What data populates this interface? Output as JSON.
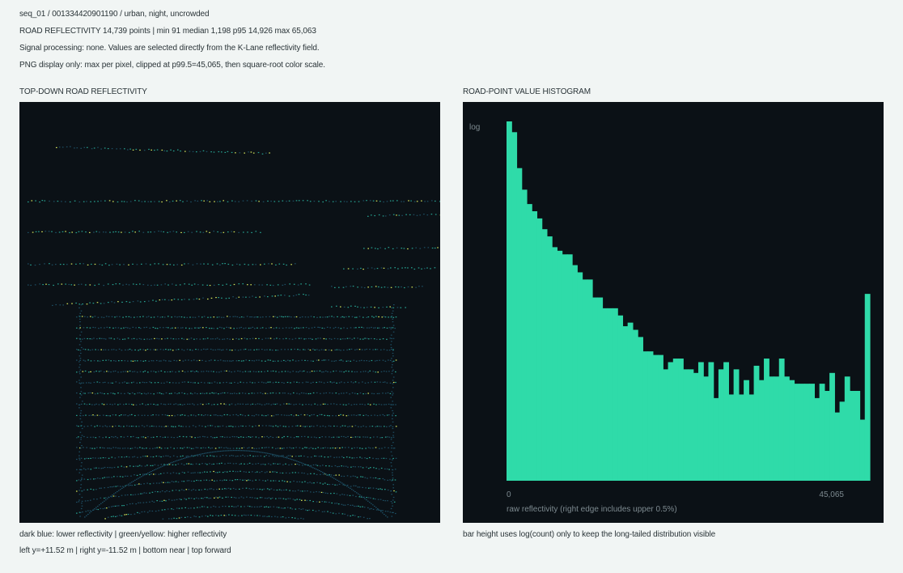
{
  "header": {
    "seq": "seq_01 / 001334420901190 / urban, night, uncrowded",
    "stats": "ROAD REFLECTIVITY 14,739 points | min 91  median 1,198  p95 14,926  max 65,063",
    "processing": "Signal processing: none. Values are selected directly from the K-Lane reflectivity field.",
    "display": "PNG display only: max per pixel, clipped at p99.5=45,065, then square-root color scale."
  },
  "topdown": {
    "title": "TOP-DOWN ROAD REFLECTIVITY",
    "legend": "dark blue: lower reflectivity | green/yellow: higher reflectivity",
    "axes_note": "left y=+11.52 m | right y=-11.52 m | bottom near | top forward"
  },
  "histogram": {
    "title": "ROAD-POINT VALUE HISTOGRAM",
    "log_label": "log",
    "note": "bar height uses log(count) only to keep the long-tailed distribution visible"
  },
  "colors": {
    "background": "#f1f5f4",
    "panel": "#0b1116",
    "bar": "#2fdba9",
    "low": "#1d4e63",
    "mid": "#27a392",
    "high": "#d8e85c"
  },
  "chart_data": [
    {
      "type": "scatter",
      "title": "TOP-DOWN ROAD REFLECTIVITY",
      "xlabel": "",
      "ylabel": "",
      "ylim": [
        -11.52,
        11.52
      ],
      "point_count": 14739,
      "color_scale": "sqrt",
      "clip": 45065,
      "orientation": "bottom near, top forward"
    },
    {
      "type": "bar",
      "title": "ROAD-POINT VALUE HISTOGRAM",
      "xlabel": "raw reflectivity (right edge includes upper 0.5%)",
      "ylabel": "log",
      "xlim": [
        0,
        45065
      ],
      "x_tick_labels": [
        "0",
        "45,065"
      ],
      "yscale": "log",
      "log_heights": [
        1.0,
        0.97,
        0.87,
        0.81,
        0.77,
        0.75,
        0.73,
        0.7,
        0.68,
        0.65,
        0.64,
        0.63,
        0.63,
        0.6,
        0.58,
        0.56,
        0.56,
        0.51,
        0.51,
        0.48,
        0.48,
        0.48,
        0.46,
        0.43,
        0.44,
        0.42,
        0.4,
        0.36,
        0.36,
        0.35,
        0.35,
        0.31,
        0.33,
        0.34,
        0.34,
        0.31,
        0.31,
        0.3,
        0.33,
        0.29,
        0.33,
        0.23,
        0.31,
        0.33,
        0.24,
        0.31,
        0.24,
        0.28,
        0.24,
        0.32,
        0.28,
        0.34,
        0.29,
        0.29,
        0.34,
        0.29,
        0.28,
        0.27,
        0.27,
        0.27,
        0.27,
        0.23,
        0.27,
        0.25,
        0.3,
        0.19,
        0.22,
        0.29,
        0.25,
        0.25,
        0.17,
        0.52
      ]
    }
  ]
}
